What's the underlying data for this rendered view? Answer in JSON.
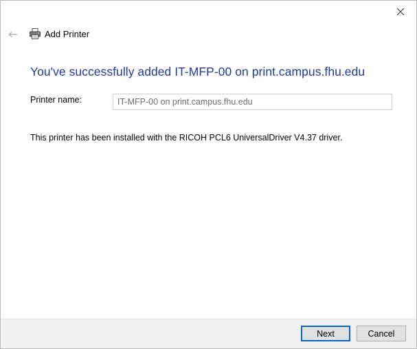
{
  "window": {
    "title": "Add Printer"
  },
  "content": {
    "heading": "You've successfully added IT-MFP-00 on print.campus.fhu.edu",
    "printer_name_label": "Printer name:",
    "printer_name_value": "IT-MFP-00 on print.campus.fhu.edu",
    "driver_message": "This printer has been installed with the RICOH PCL6 UniversalDriver V4.37 driver."
  },
  "footer": {
    "next_label": "Next",
    "cancel_label": "Cancel"
  },
  "icons": {
    "close": "close-icon",
    "back": "back-arrow-icon",
    "printer": "printer-icon"
  },
  "colors": {
    "heading": "#1e3b9a",
    "primary_button_border": "#0a63c7",
    "footer_background": "#f0f0f0"
  }
}
